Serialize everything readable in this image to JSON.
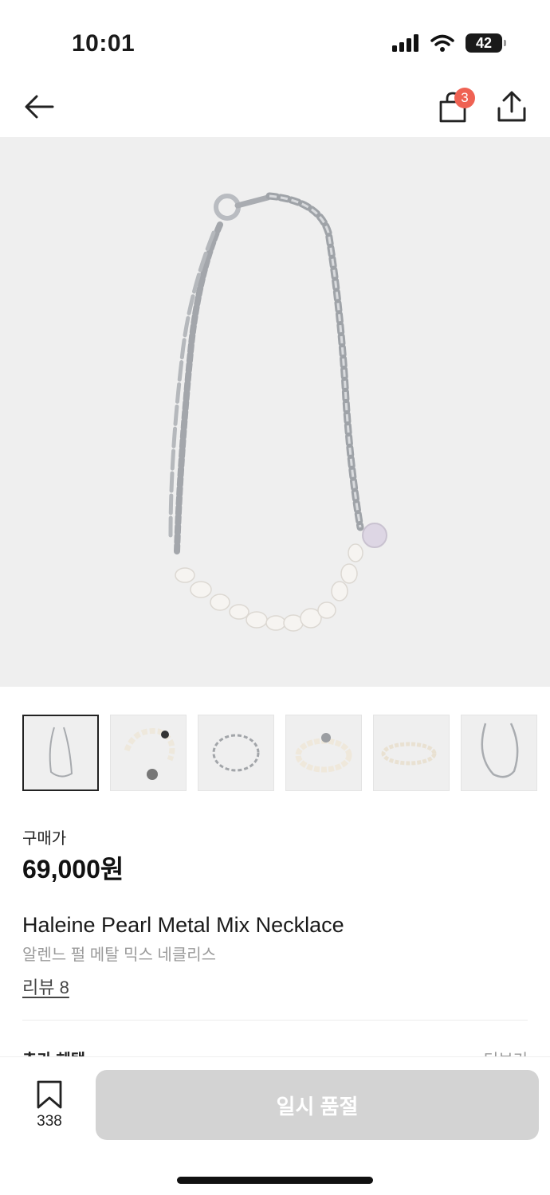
{
  "status_bar": {
    "time": "10:01",
    "battery": "42"
  },
  "nav": {
    "cart_count": "3"
  },
  "product": {
    "price_label": "구매가",
    "price": "69,000원",
    "name_en": "Haleine Pearl Metal Mix Necklace",
    "name_ko": "알렌느 펄 메탈 믹스 네클리스",
    "review_link": "리뷰 8",
    "thumbnails": [
      "necklace",
      "bracelet-mixed",
      "bracelet-chain",
      "bracelet-pearl",
      "bracelet-thin",
      "necklace-pearl"
    ]
  },
  "section_peek": {
    "title": "추가 혜택",
    "more": "더보기"
  },
  "bottom_bar": {
    "bookmark_count": "338",
    "soldout_label": "일시 품절"
  },
  "colors": {
    "badge": "#ef6253",
    "image_bg": "#efefef",
    "disabled_button": "#d3d3d3"
  }
}
